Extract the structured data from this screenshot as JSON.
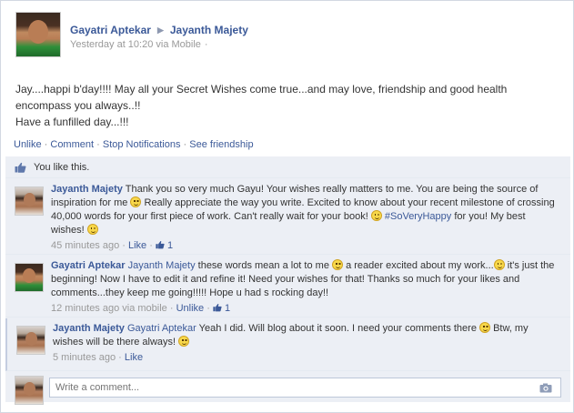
{
  "post": {
    "author": "Gayatri Aptekar",
    "target": "Jayanth Majety",
    "time": "Yesterday at 10:20 via Mobile",
    "dot": "·",
    "message_line1": "Jay....happi b'day!!!! May all your Secret Wishes come true...and may love, friendship and good health encompass you always..!!",
    "message_line2": "Have a funfilled day...!!!"
  },
  "actions": {
    "unlike": "Unlike",
    "comment": "Comment",
    "stop_notifications": "Stop Notifications",
    "see_friendship": "See friendship",
    "separator": "·"
  },
  "likes": {
    "text": "You like this."
  },
  "comments": [
    {
      "author": "Jayanth Majety",
      "text_part1": "Thank you so very much Gayu! Your wishes really matters to me. You are being the source of inspiration for me",
      "text_part2": "Really appreciate the way you write. Excited to know about your recent milestone of crossing 40,000 words for your first piece of work. Can't really wait for your book!",
      "hashtag": "#SoVeryHappy",
      "text_part3": "for you! My best wishes!",
      "time": "45 minutes ago",
      "like_link": "Like",
      "like_count": "1"
    },
    {
      "author": "Gayatri Aptekar",
      "mention": "Jayanth Majety",
      "text_part1": "these words mean a lot to me",
      "text_part2": "a reader excited about my work...",
      "text_part3": "it's just the beginning! Now I have to edit it and refine it! Need your wishes for that! Thanks so much for your likes and comments...they keep me going!!!!! Hope u had s rocking day!!",
      "time": "12 minutes ago via mobile",
      "like_link": "Unlike",
      "like_count": "1"
    },
    {
      "author": "Jayanth Majety",
      "mention": "Gayatri Aptekar",
      "text_part1": "Yeah I did. Will blog about it soon. I need your comments there",
      "text_part2": "Btw, my wishes will be there always!",
      "time": "5 minutes ago",
      "like_link": "Like"
    }
  ],
  "composer": {
    "placeholder": "Write a comment..."
  }
}
